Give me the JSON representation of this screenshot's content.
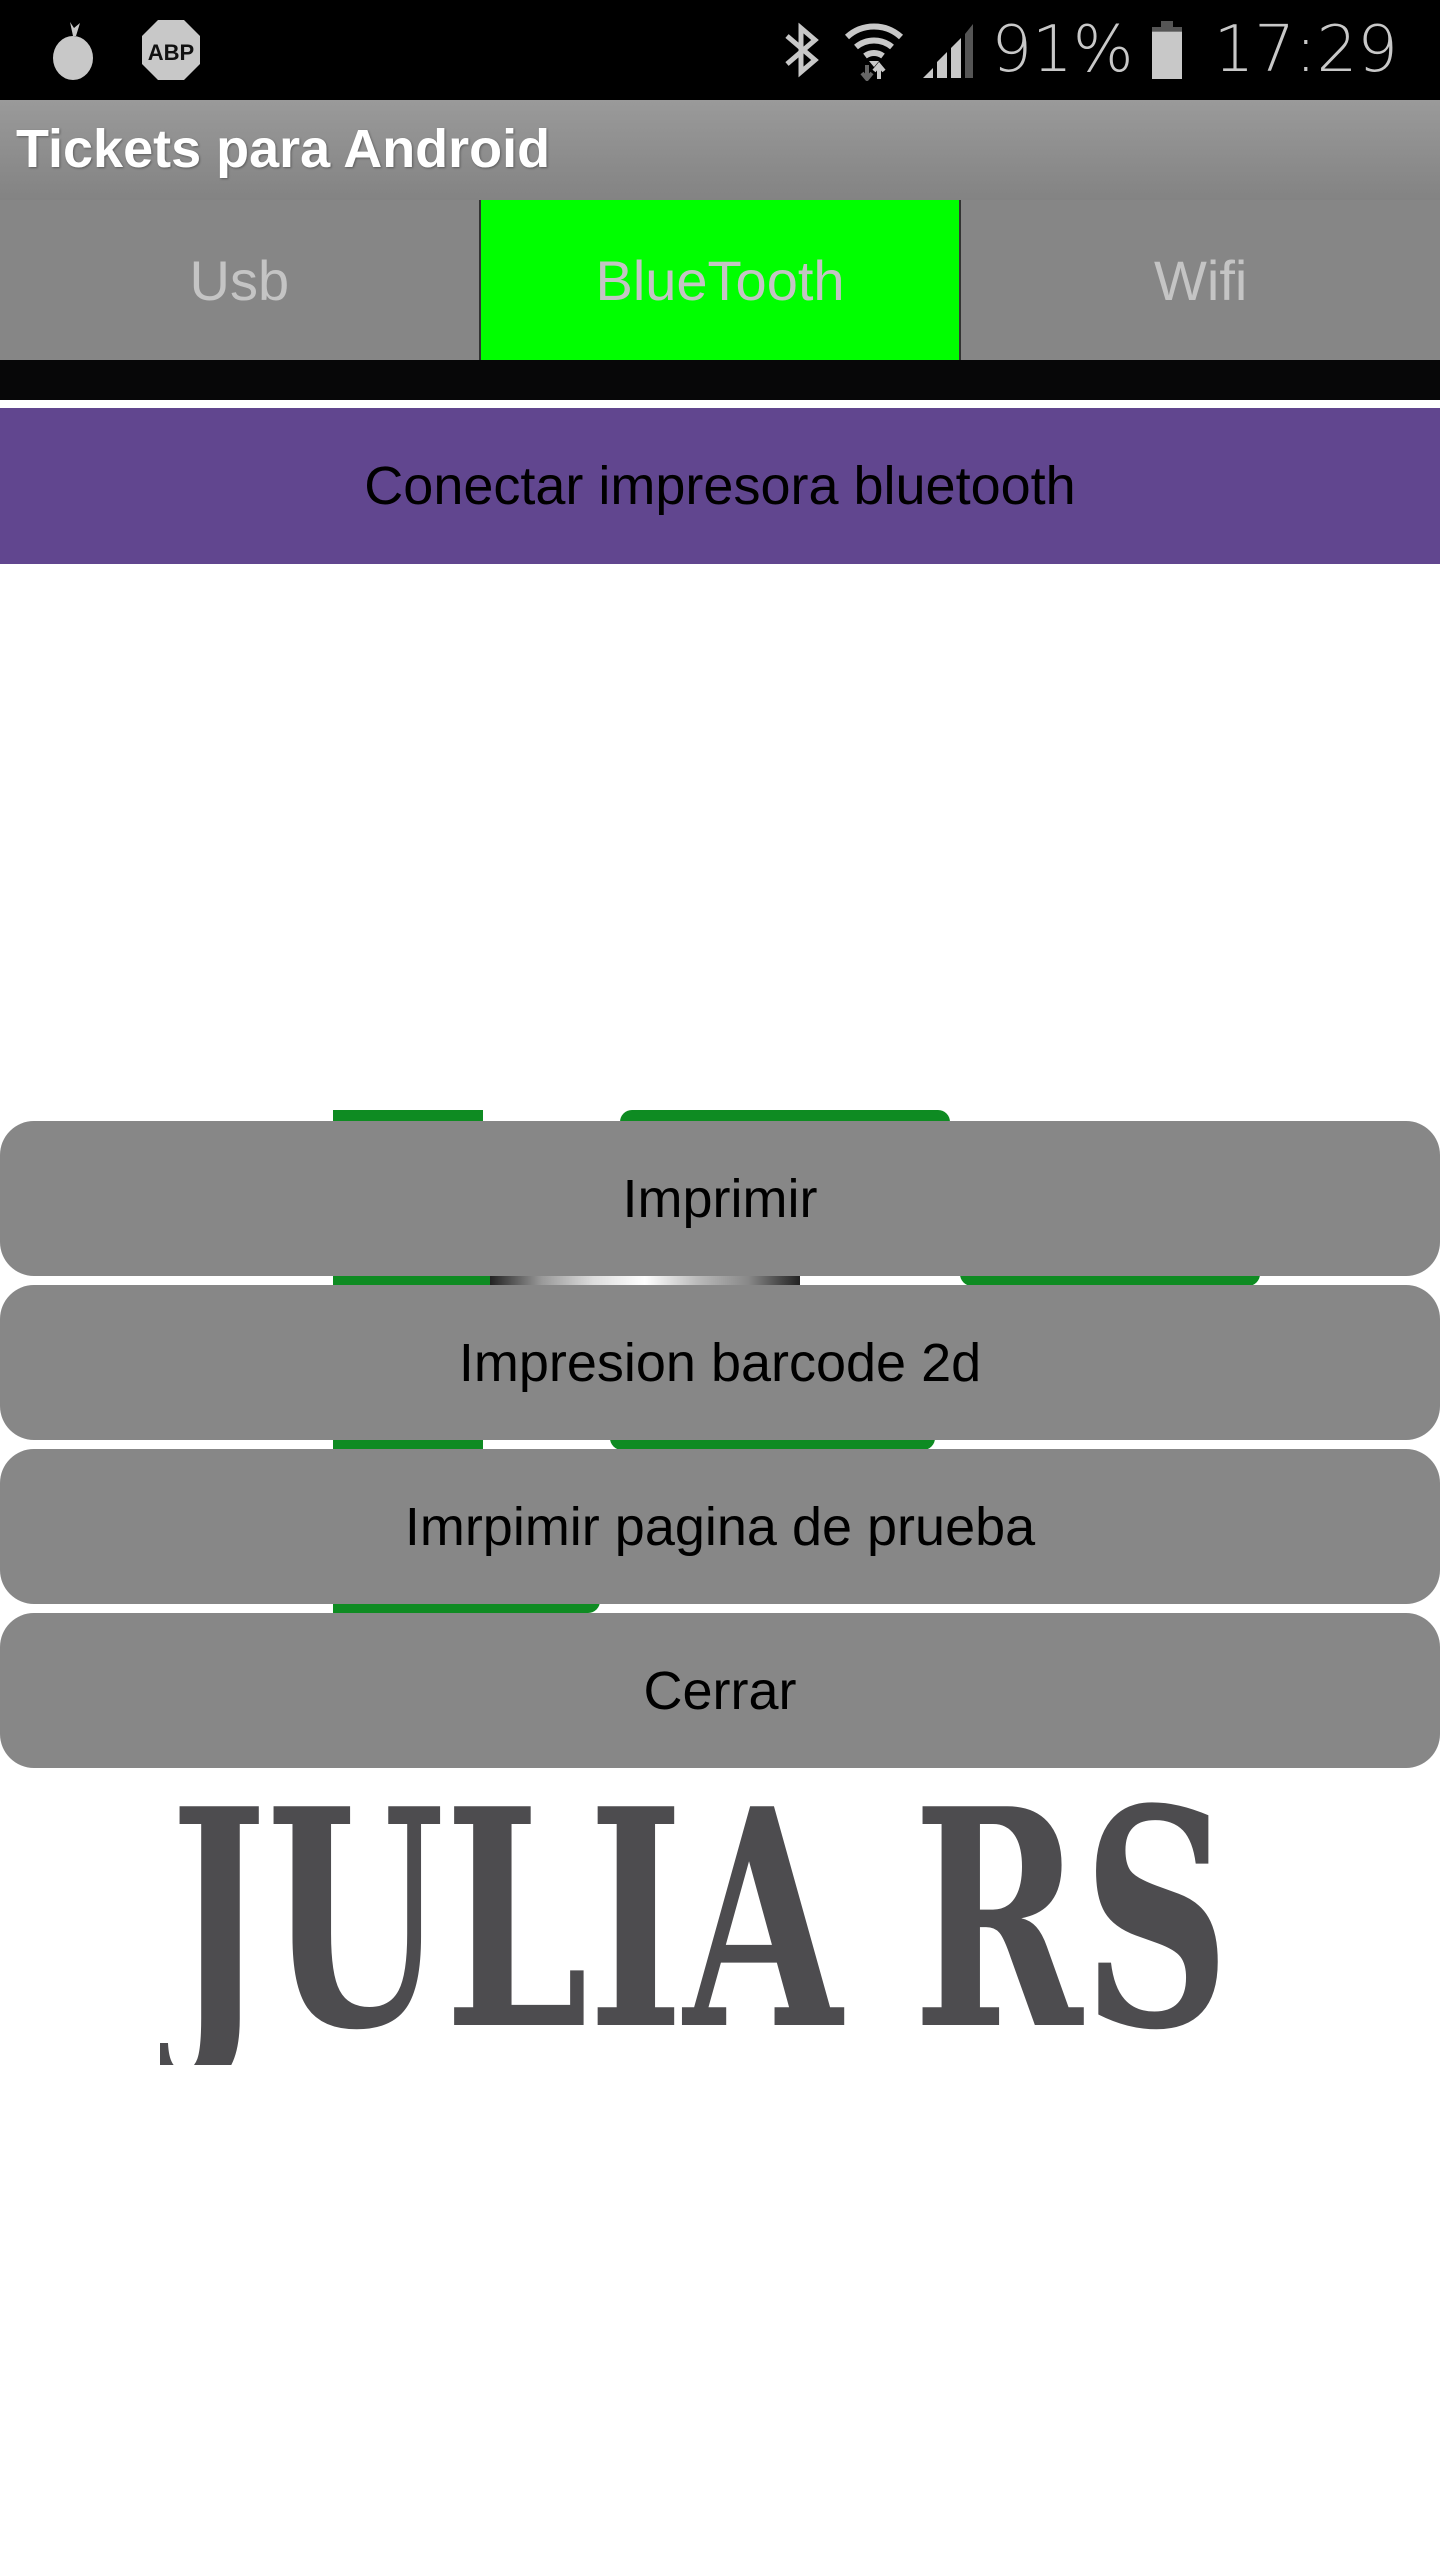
{
  "status_bar": {
    "left_icons": [
      "onion-notification-icon",
      "adblock-plus-icon"
    ],
    "abp_label": "ABP",
    "right_icons": [
      "bluetooth-icon",
      "wifi-icon",
      "signal-icon"
    ],
    "battery_percent": "91%",
    "battery_level": 0.91,
    "time": "17:29"
  },
  "app": {
    "title": "Tickets para Android"
  },
  "tabs": [
    {
      "label": "Usb",
      "active": false
    },
    {
      "label": "BlueTooth",
      "active": true
    },
    {
      "label": "Wifi",
      "active": false
    }
  ],
  "colors": {
    "active_tab": "#00ff00",
    "connect_button": "#61468f",
    "action_button": "#878787",
    "logo_green": "#0e8b22",
    "logo_text": "#4d4c4f"
  },
  "connect_button": {
    "label": "Conectar impresora bluetooth"
  },
  "actions": [
    {
      "label": "Imprimir"
    },
    {
      "label": "Impresion barcode 2d"
    },
    {
      "label": "Imrpimir pagina de prueba"
    },
    {
      "label": "Cerrar"
    }
  ],
  "logo": {
    "text": "JULIA RS"
  }
}
